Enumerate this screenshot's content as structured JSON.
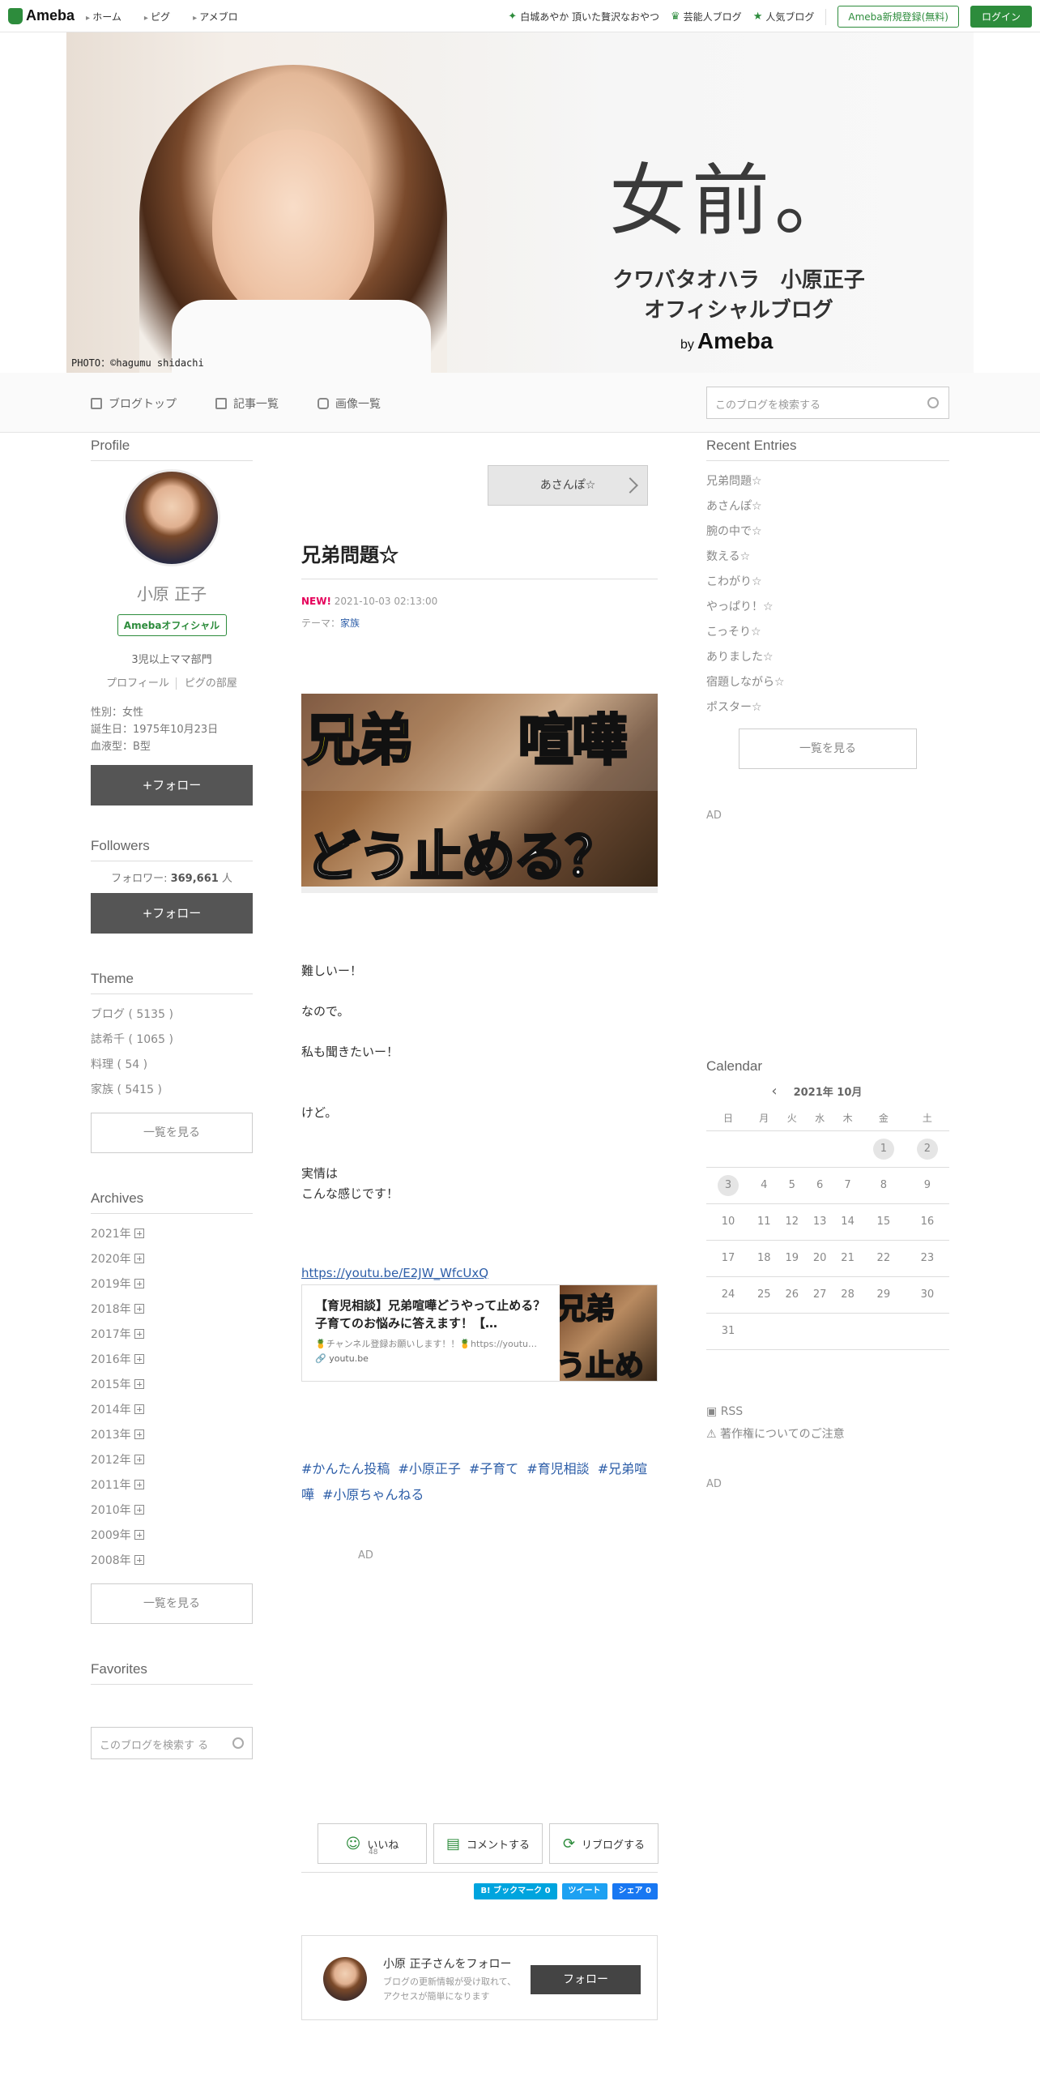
{
  "topbar": {
    "logo": "Ameba",
    "nav": [
      "ホーム",
      "ピグ",
      "アメブロ"
    ],
    "links": [
      {
        "icon": "sparkle-icon",
        "label": "白城あやか 頂いた贅沢なおやつ"
      },
      {
        "icon": "crown-icon",
        "label": "芸能人ブログ"
      },
      {
        "icon": "star-icon",
        "label": "人気ブログ"
      }
    ],
    "register": "Ameba新規登録(無料)",
    "login": "ログイン"
  },
  "header": {
    "credit": "PHOTO：©hagumu shidachi",
    "title": "女前。",
    "subtitle1": "クワバタオハラ　小原正子",
    "subtitle2": "オフィシャルブログ",
    "by": "by",
    "brand": "Ameba"
  },
  "blognav": {
    "items": [
      "ブログトップ",
      "記事一覧",
      "画像一覧"
    ],
    "search_placeholder": "このブログを検索する"
  },
  "profile": {
    "title": "Profile",
    "name": "小原 正子",
    "badge": "Amebaオフィシャル",
    "desc": "3児以上ママ部門",
    "links": [
      "プロフィール",
      "ピグの部屋"
    ],
    "info": [
      "性別：女性",
      "誕生日：1975年10月23日",
      "血液型：B型"
    ],
    "follow": "+フォロー"
  },
  "followers": {
    "title": "Followers",
    "label": "フォロワー: ",
    "count": "369,661",
    "unit": " 人",
    "follow": "+フォロー"
  },
  "theme": {
    "title": "Theme",
    "items": [
      "ブログ ( 5135 )",
      "誌希千 ( 1065 )",
      "料理 ( 54 )",
      "家族 ( 5415 )"
    ],
    "more": "一覧を見る"
  },
  "archives": {
    "title": "Archives",
    "items": [
      "2021年",
      "2020年",
      "2019年",
      "2018年",
      "2017年",
      "2016年",
      "2015年",
      "2014年",
      "2013年",
      "2012年",
      "2011年",
      "2010年",
      "2009年",
      "2008年"
    ],
    "more": "一覧を見る"
  },
  "favorites": {
    "title": "Favorites",
    "search_placeholder": "このブログを検索す る"
  },
  "entry": {
    "prev": "あさんぽ☆",
    "title": "兄弟問題☆",
    "new": "NEW!",
    "date": " 2021-10-03 02:13:00",
    "theme_label": "テーマ：",
    "theme": "家族",
    "image_text1": "兄弟",
    "image_text1b": "喧嘩",
    "image_text2": "どう止める？",
    "body": [
      "難しいー！",
      "なので。",
      "私も聞きたいー！",
      "けど。",
      "実情は",
      "こんな感じです！"
    ],
    "link": "https://youtu.be/E2JW_WfcUxQ",
    "card_title": "【育児相談】兄弟喧嘩どうやって止める？子育てのお悩みに答えます！【…",
    "card_desc": "🍍チャンネル登録お願いします！！🍍https://youtu…",
    "card_source": "youtu.be",
    "card_thumb1": "兄弟",
    "card_thumb2": "う止める",
    "tags": [
      "#かんたん投稿",
      "#小原正子",
      "#子育て",
      "#育児相談",
      "#兄弟喧嘩",
      "#小原ちゃんねる"
    ],
    "ad": "AD"
  },
  "actions": {
    "like": "いいね",
    "like_count": "48",
    "comment": "コメントする",
    "reblog": "リブログする",
    "shares": [
      {
        "label": "B! ブックマーク  0",
        "color": "#00a4de"
      },
      {
        "label": "ツイート",
        "color": "#1da1f2"
      },
      {
        "label": "シェア 0",
        "color": "#1877f2"
      }
    ]
  },
  "followbox": {
    "name": "小原 正子さんをフォロー",
    "desc": "ブログの更新情報が受け取れて、アクセスが簡単になります",
    "button": "フォロー"
  },
  "recent": {
    "title": "Recent Entries",
    "items": [
      "兄弟問題☆",
      "あさんぽ☆",
      "腕の中で☆",
      "数える☆",
      "こわがり☆",
      "やっぱり！☆",
      "こっそり☆",
      "ありました☆",
      "宿題しながら☆",
      "ポスター☆"
    ],
    "more": "一覧を見る",
    "ad": "AD"
  },
  "calendar": {
    "title": "Calendar",
    "month": "2021年 10月",
    "weekdays": [
      "日",
      "月",
      "火",
      "水",
      "木",
      "金",
      "土"
    ],
    "weeks": [
      [
        "",
        "",
        "",
        "",
        "",
        "1",
        "2"
      ],
      [
        "3",
        "4",
        "5",
        "6",
        "7",
        "8",
        "9"
      ],
      [
        "10",
        "11",
        "12",
        "13",
        "14",
        "15",
        "16"
      ],
      [
        "17",
        "18",
        "19",
        "20",
        "21",
        "22",
        "23"
      ],
      [
        "24",
        "25",
        "26",
        "27",
        "28",
        "29",
        "30"
      ],
      [
        "31",
        "",
        "",
        "",
        "",
        "",
        ""
      ]
    ],
    "highlighted": [
      "1",
      "2",
      "3"
    ]
  },
  "footer_links": {
    "rss": "RSS",
    "copyright": "著作権についてのご注意",
    "ad": "AD"
  },
  "colors": {
    "accent": "#2d8c3c",
    "link": "#2d5ea8",
    "new": "#e5005a",
    "button_dark": "#555555"
  }
}
